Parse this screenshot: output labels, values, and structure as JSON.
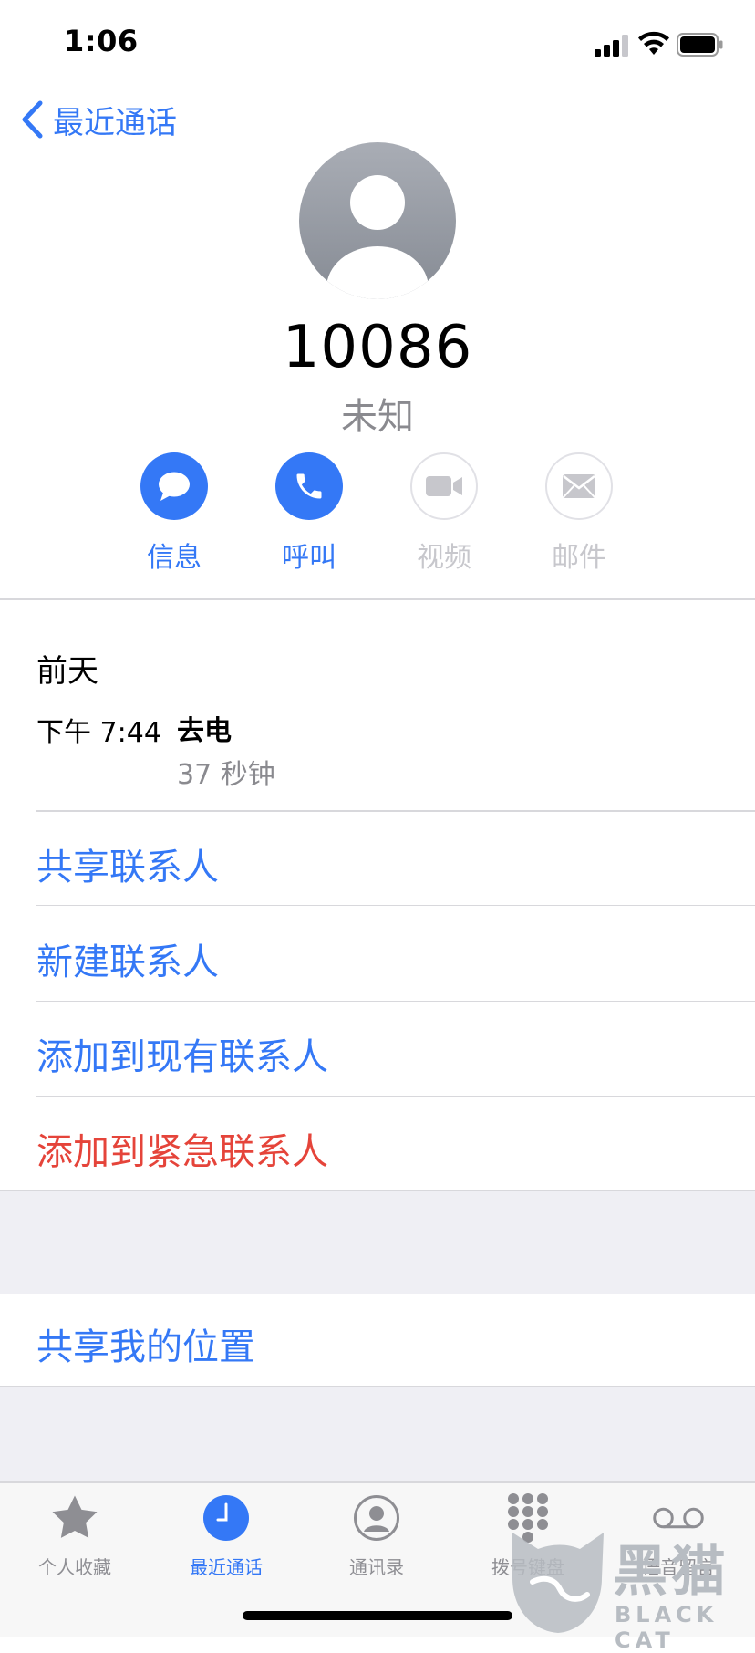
{
  "status_bar": {
    "time": "1:06"
  },
  "nav": {
    "back_label": "最近通话"
  },
  "contact": {
    "number": "10086",
    "label": "未知"
  },
  "actions": [
    {
      "label": "信息",
      "icon": "message-icon",
      "enabled": true
    },
    {
      "label": "呼叫",
      "icon": "phone-icon",
      "enabled": true
    },
    {
      "label": "视频",
      "icon": "video-icon",
      "enabled": false
    },
    {
      "label": "邮件",
      "icon": "mail-icon",
      "enabled": false
    }
  ],
  "history": {
    "day": "前天",
    "time": "下午 7:44",
    "direction": "去电",
    "duration": "37 秒钟"
  },
  "options": [
    {
      "label": "共享联系人"
    },
    {
      "label": "新建联系人"
    },
    {
      "label": "添加到现有联系人"
    },
    {
      "label": "添加到紧急联系人",
      "destructive": true
    }
  ],
  "location": {
    "label": "共享我的位置"
  },
  "tabs": [
    {
      "label": "个人收藏",
      "icon": "star-icon"
    },
    {
      "label": "最近通话",
      "icon": "clock-icon",
      "active": true
    },
    {
      "label": "通讯录",
      "icon": "contacts-icon"
    },
    {
      "label": "拨号键盘",
      "icon": "keypad-icon"
    },
    {
      "label": "语音留言",
      "icon": "voicemail-icon"
    }
  ],
  "watermark": {
    "text": "黑猫",
    "sub": "BLACK CAT"
  },
  "colors": {
    "accent": "#3478f6",
    "destructive": "#e5443a",
    "secondary_text": "#8a8a8f",
    "grouped_bg": "#efeff4"
  }
}
